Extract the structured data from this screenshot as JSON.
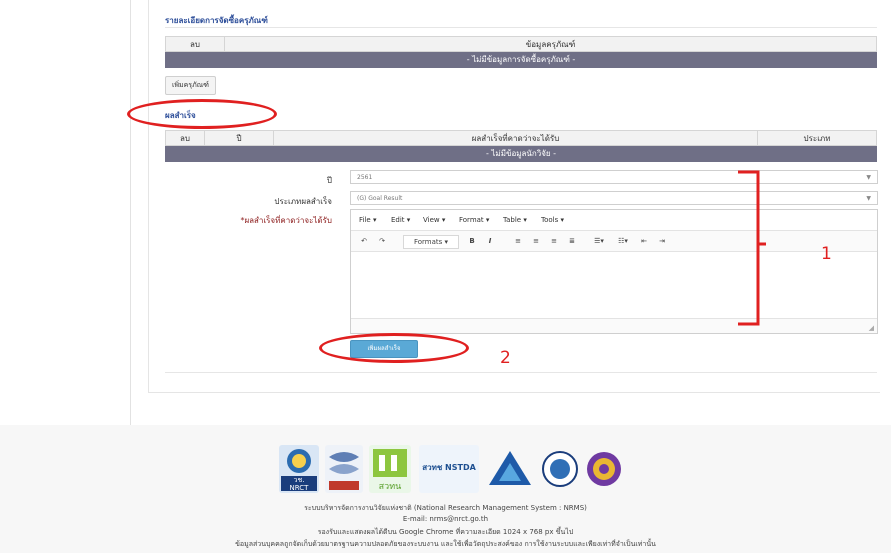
{
  "equipment_section": {
    "title": "รายละเอียดการจัดซื้อครุภัณฑ์",
    "col_delete": "ลบ",
    "col_info": "ข้อมูลครุภัณฑ์",
    "empty_text": "- ไม่มีข้อมูลการจัดซื้อครุภัณฑ์ -",
    "add_button": "เพิ่มครุภัณฑ์"
  },
  "result_section": {
    "title": "ผลสำเร็จ",
    "col_delete": "ลบ",
    "col_year": "ปี",
    "col_expected": "ผลสำเร็จที่คาดว่าจะได้รับ",
    "col_type": "ประเภท",
    "empty_text": "- ไม่มีข้อมูลนักวิจัย -"
  },
  "form": {
    "year_label": "ปี",
    "year_value": "2561",
    "type_label": "ประเภทผลสำเร็จ",
    "type_value": "(G) Goal Result",
    "expected_label": "*ผลสำเร็จที่คาดว่าจะได้รับ",
    "submit_button": "เพิ่มผลสำเร็จ"
  },
  "editor": {
    "menu": [
      "File ▾",
      "Edit ▾",
      "View ▾",
      "Format ▾",
      "Table ▾",
      "Tools ▾"
    ],
    "formats_label": "Formats ▾",
    "bold": "B",
    "italic": "I"
  },
  "annotations": {
    "label_1": "1",
    "label_2": "2",
    "color": "#e02020"
  },
  "footer": {
    "system_name": "ระบบบริหารจัดการงานวิจัยแห่งชาติ (National Research Management System : NRMS)",
    "email": "E-mail: nrms@nrct.go.th",
    "browser_note": "รองรับและแสดงผลได้ดีบน Google Chrome ที่ความละเอียด 1024 x 768 px ขึ้นไป",
    "disclaimer": "ข้อมูลส่วนบุคคลถูกจัดเก็บด้วยมาตรฐานความปลอดภัยของระบบงาน และใช้เพื่อวัตถุประสงค์ของ การใช้งานระบบและเพียงเท่าที่จำเป็นเท่านั้น",
    "logo_nrct_text": "วช.",
    "logo_nrct_sub": "NRCT",
    "logo_tsri_text": "สวทน",
    "logo_nstda_text": "สวทช NSTDA"
  }
}
